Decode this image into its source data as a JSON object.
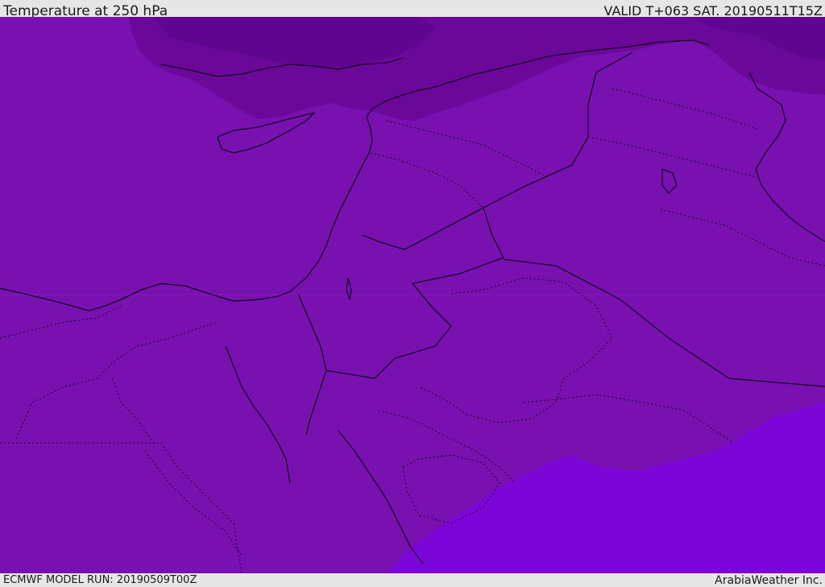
{
  "header": {
    "title": "Temperature at 250 hPa",
    "valid": "VALID T+063 SAT. 20190511T15Z"
  },
  "footer": {
    "model_run": "ECMWF MODEL RUN: 20190509T00Z",
    "credit": "ArabiaWeather Inc."
  },
  "map": {
    "colors": {
      "base": "#7811b0",
      "cold": "#6a0899",
      "colder": "#5f058e",
      "warm": "#7c05d8",
      "border": "#000000"
    }
  }
}
